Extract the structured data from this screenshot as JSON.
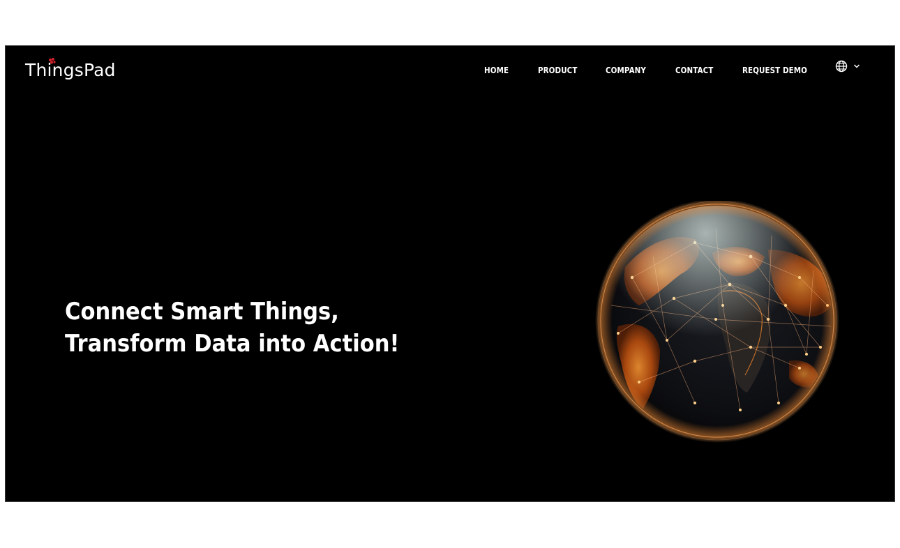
{
  "brand": {
    "name": "ThingsPad",
    "accent_color": "#d4202c",
    "logo_icon": "red-hexagon-cluster-icon"
  },
  "nav": {
    "items": [
      {
        "label": "HOME"
      },
      {
        "label": "PRODUCT"
      },
      {
        "label": "COMPANY"
      },
      {
        "label": "CONTACT"
      },
      {
        "label": "REQUEST DEMO"
      }
    ],
    "language_icon": "globe-icon",
    "dropdown_icon": "chevron-down-icon"
  },
  "hero": {
    "headline_line1": "Connect Smart Things,",
    "headline_line2": "Transform Data into Action!",
    "image_description_icon": "glowing-network-earth-globe",
    "glow_color": "#ff7a1a"
  }
}
